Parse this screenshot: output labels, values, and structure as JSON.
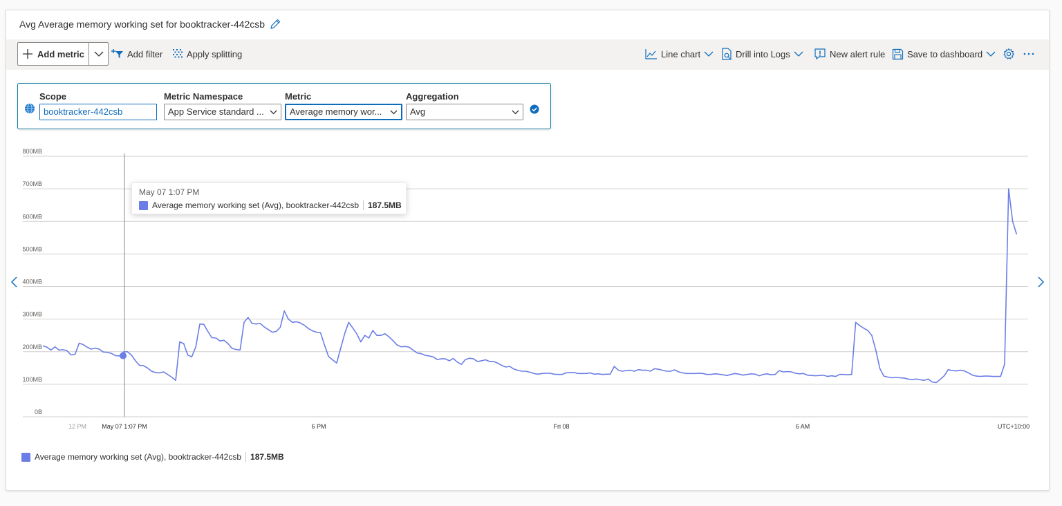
{
  "header": {
    "title": "Avg Average memory working set for booktracker-442csb"
  },
  "toolbar": {
    "add_metric": "Add metric",
    "add_filter": "Add filter",
    "apply_splitting": "Apply splitting",
    "chart_type": "Line chart",
    "drill_logs": "Drill into Logs",
    "new_alert": "New alert rule",
    "save_dashboard": "Save to dashboard"
  },
  "selector": {
    "scope_label": "Scope",
    "scope_value": "booktracker-442csb",
    "namespace_label": "Metric Namespace",
    "namespace_value": "App Service standard ...",
    "metric_label": "Metric",
    "metric_value": "Average memory wor...",
    "aggregation_label": "Aggregation",
    "aggregation_value": "Avg"
  },
  "tooltip": {
    "time": "May 07 1:07 PM",
    "series": "Average memory working set (Avg), booktracker-442csb",
    "value": "187.5MB"
  },
  "legend": {
    "series": "Average memory working set (Avg), booktracker-442csb",
    "value": "187.5MB"
  },
  "colors": {
    "series": "#6b7ee6",
    "accent": "#0f6cbd"
  },
  "chart_data": {
    "type": "line",
    "y_ticks": [
      "800MB",
      "700MB",
      "600MB",
      "500MB",
      "400MB",
      "300MB",
      "200MB",
      "100MB",
      "0B"
    ],
    "x_ticks": [
      "12 PM",
      "May 07 1:07 PM",
      "6 PM",
      "Fri 08",
      "6 AM",
      "UTC+10:00"
    ],
    "ylim": [
      0,
      800
    ],
    "y_unit": "MB",
    "grid": true,
    "cursor_label": "May 07 1:07 PM",
    "series": [
      {
        "name": "Average memory working set (Avg), booktracker-442csb",
        "x_hours": [
          0,
          0.3,
          0.6,
          0.9,
          1.2,
          1.5,
          1.8,
          2.1,
          2.4,
          2.7,
          3.0,
          3.3,
          3.6,
          3.9,
          4.2,
          4.5,
          4.8,
          5.1,
          5.4,
          5.7,
          6.0,
          6.3,
          6.6,
          6.9,
          7.2,
          7.5,
          7.8,
          8.1,
          8.4,
          8.7,
          9.0,
          9.3,
          9.6,
          9.9,
          10.2,
          10.5,
          10.8,
          11.1,
          11.4,
          11.7,
          12.0,
          12.3,
          12.6,
          12.9,
          13.2,
          13.5,
          13.8,
          14.1,
          14.4,
          14.7,
          15.0,
          15.3,
          15.6,
          15.9,
          16.2,
          16.5,
          16.8,
          17.1,
          17.4,
          17.7,
          18.0,
          18.3,
          18.6,
          18.9,
          19.2,
          19.5,
          19.8,
          20.1,
          20.4,
          20.7,
          21.0,
          21.3,
          21.6,
          21.9,
          22.2,
          22.5,
          22.8,
          23.1,
          23.4,
          23.7,
          24.0,
          24.3,
          24.6,
          24.9,
          25.2,
          25.5,
          25.8,
          26.1,
          26.4,
          26.7,
          27.0,
          27.3,
          27.6,
          27.9,
          28.2,
          28.5,
          28.8,
          29.1,
          29.4,
          29.7,
          30.0,
          30.3,
          30.6,
          30.9,
          31.2,
          31.5,
          31.8,
          32.1,
          32.4,
          32.7,
          33.0,
          33.3,
          33.6,
          33.9,
          34.2,
          34.5,
          34.8,
          35.1,
          35.4,
          35.7,
          36.0,
          36.3,
          36.6,
          36.9,
          37.2,
          37.5,
          37.8,
          38.1,
          38.4,
          38.7,
          39.0,
          39.3,
          39.6,
          39.9,
          40.2,
          40.5,
          40.8,
          41.1,
          41.4,
          41.7,
          42.0,
          42.3,
          42.6,
          42.9,
          43.2,
          43.5,
          43.8,
          44.1,
          44.4,
          44.7,
          45.0,
          45.3,
          45.6,
          45.9,
          46.2,
          46.5,
          46.8,
          47.1,
          47.4,
          47.7,
          48.0,
          48.3,
          48.6,
          48.9,
          49.2,
          49.5,
          49.8,
          50.1,
          50.4,
          50.7,
          51.0,
          51.3,
          51.6,
          51.9,
          52.2,
          52.5,
          52.8,
          53.1,
          53.4,
          53.7,
          54.0,
          54.3,
          54.6,
          54.9,
          55.2,
          55.5,
          55.8,
          56.1,
          56.4,
          56.7,
          57.0,
          57.3,
          57.6,
          57.9,
          58.2,
          58.5,
          58.8,
          59.1,
          59.4,
          59.7,
          60.0,
          60.3,
          60.6,
          60.9,
          61.2,
          61.5,
          61.8,
          62.1,
          62.4,
          62.7,
          63.0,
          63.3,
          63.6,
          63.9,
          64.2,
          64.5,
          64.8,
          65.1,
          65.4,
          65.7,
          66.0,
          66.3,
          66.6,
          66.9,
          67.2,
          67.5,
          67.8,
          68.1,
          68.4,
          68.7,
          69.0,
          69.3,
          69.6,
          69.9,
          70.2,
          70.5,
          70.8,
          71.1,
          71.4,
          71.7,
          72.0,
          72.3,
          72.6,
          72.9,
          73.2,
          73.5,
          73.8,
          74.1,
          74.4
        ],
        "values": [
          218,
          214,
          205,
          215,
          205,
          206,
          203,
          190,
          192,
          226,
          222,
          214,
          208,
          211,
          208,
          199,
          198,
          195,
          188,
          187,
          199,
          200,
          190,
          172,
          158,
          157,
          150,
          140,
          136,
          135,
          138,
          130,
          122,
          112,
          230,
          225,
          190,
          184,
          215,
          285,
          284,
          262,
          243,
          242,
          233,
          235,
          225,
          210,
          207,
          205,
          290,
          305,
          287,
          285,
          287,
          276,
          268,
          260,
          262,
          275,
          325,
          300,
          290,
          292,
          288,
          281,
          271,
          264,
          260,
          258,
          220,
          185,
          175,
          165,
          210,
          255,
          290,
          273,
          255,
          230,
          250,
          242,
          265,
          250,
          250,
          255,
          246,
          234,
          221,
          215,
          216,
          214,
          205,
          196,
          194,
          189,
          187,
          184,
          176,
          178,
          178,
          172,
          179,
          168,
          161,
          176,
          180,
          178,
          170,
          172,
          175,
          170,
          170,
          165,
          158,
          153,
          155,
          147,
          143,
          140,
          140,
          137,
          133,
          131,
          133,
          134,
          134,
          131,
          130,
          130,
          135,
          136,
          136,
          133,
          133,
          133,
          135,
          131,
          132,
          130,
          131,
          131,
          155,
          143,
          140,
          142,
          143,
          140,
          145,
          143,
          143,
          140,
          148,
          146,
          143,
          140,
          140,
          144,
          138,
          135,
          133,
          133,
          133,
          134,
          133,
          130,
          130,
          132,
          131,
          129,
          127,
          130,
          133,
          131,
          128,
          130,
          132,
          131,
          126,
          130,
          132,
          129,
          130,
          142,
          138,
          139,
          138,
          134,
          132,
          133,
          128,
          127,
          126,
          127,
          128,
          124,
          126,
          124,
          130,
          130,
          129,
          130,
          290,
          280,
          272,
          265,
          250,
          205,
          148,
          125,
          122,
          120,
          121,
          120,
          119,
          116,
          114,
          116,
          114,
          112,
          116,
          107,
          105,
          115,
          126,
          145,
          142,
          141,
          143,
          141,
          135,
          128,
          125,
          124,
          125,
          125,
          124,
          124,
          124,
          162,
          700,
          600,
          560
        ]
      }
    ]
  }
}
